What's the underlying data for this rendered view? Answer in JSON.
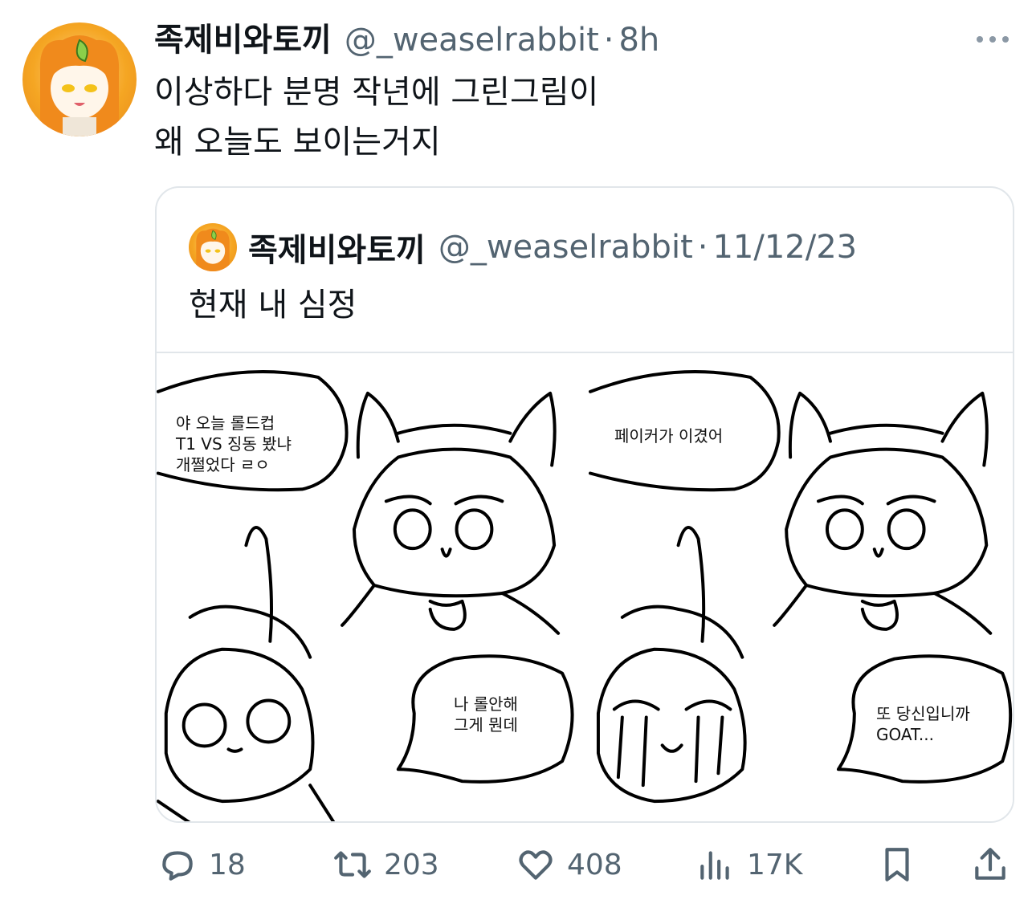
{
  "tweet": {
    "display_name": "족제비와토끼",
    "handle": "@_weaselrabbit",
    "separator": "·",
    "time": "8h",
    "text_lines": [
      "이상하다 분명 작년에 그린그림이",
      "왜 오늘도 보이는거지"
    ]
  },
  "quote": {
    "display_name": "족제비와토끼",
    "handle": "@_weaselrabbit",
    "separator": "·",
    "date": "11/12/23",
    "text": "현재 내 심정",
    "comic": {
      "panel1_bubble": [
        "야 오늘 롤드컵",
        "T1 VS 징동 봤냐",
        "개쩔었다 ㄹㅇ"
      ],
      "panel2_bubble": [
        "나 롤안해",
        "그게 뭔데"
      ],
      "panel3_bubble": [
        "페이커가 이겼어"
      ],
      "panel4_bubble": [
        "또 당신입니까",
        "GOAT..."
      ]
    }
  },
  "actions": {
    "reply": {
      "icon": "reply-icon",
      "count": "18"
    },
    "retweet": {
      "icon": "retweet-icon",
      "count": "203"
    },
    "like": {
      "icon": "heart-icon",
      "count": "408"
    },
    "views": {
      "icon": "views-icon",
      "count": "17K"
    },
    "bookmark": {
      "icon": "bookmark-icon"
    },
    "share": {
      "icon": "share-icon"
    }
  },
  "colors": {
    "text": "#0f1419",
    "secondary": "#536471",
    "border": "#e1e6ea",
    "avatar": "#f5a623"
  }
}
